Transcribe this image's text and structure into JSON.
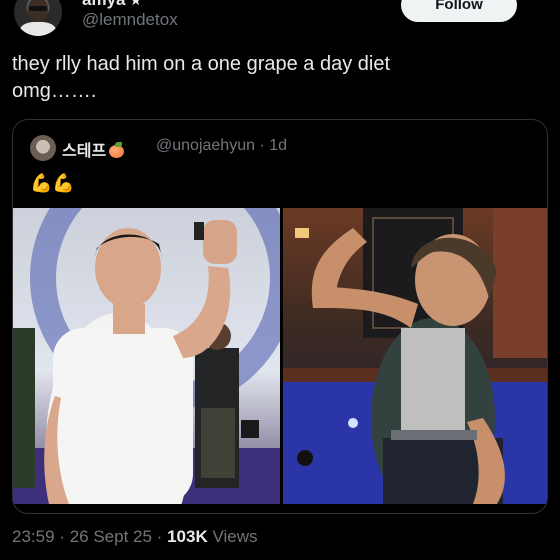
{
  "author": {
    "display_name": "amya",
    "badge": "★",
    "handle": "@lemndetox",
    "follow_label": "Follow"
  },
  "tweet": {
    "text": "they rlly had him on a one grape a day diet\nomg……."
  },
  "quoted": {
    "display_name": "스테프",
    "handle_time": "@unojaehyun · 1d",
    "text": "💪💪",
    "images": [
      {
        "description_icon": "photo-left"
      },
      {
        "description_icon": "photo-right"
      }
    ]
  },
  "footer": {
    "time": "23:59",
    "date": "26 Sept 25",
    "views_count": "103K",
    "views_label": "Views",
    "separator": "·"
  },
  "colors": {
    "background": "#000000",
    "text": "#e7e9ea",
    "secondary": "#71767b",
    "border": "#2f3336",
    "follow_bg": "#eff3f4"
  }
}
